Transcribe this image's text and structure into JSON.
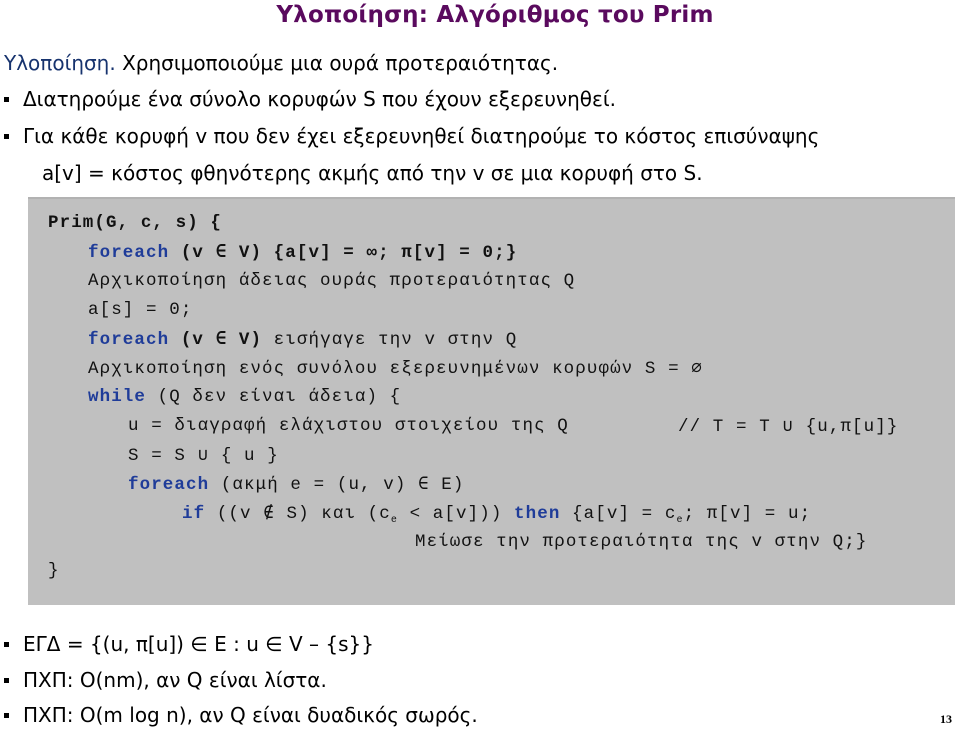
{
  "slide": {
    "title": "Υλοποίηση: Αλγόριθμος του Prim",
    "intro": {
      "keyword": "Υλοποίηση.",
      "text": " Χρησιμοποιούμε μια ουρά προτεραιότητας."
    },
    "bullets_top": [
      "Διατηρούμε ένα σύνολο κορυφών S που έχουν εξερευνηθεί.",
      "Για κάθε κορυφή v που δεν έχει εξερευνηθεί διατηρούμε το κόστος επισύναψης"
    ],
    "bullet_continuation": "a[v] = κόστος φθηνότερης ακμής από την v σε μια κορυφή στο S.",
    "code": {
      "l1": "Prim(G, c, s) {",
      "l2_kw": "foreach",
      "l2_rest": " (v ∈ V) {a[v] = ∞; π[v] = 0;}",
      "l3": "Αρχικοποίηση άδειας ουράς προτεραιότητας Q",
      "l4": "a[s] = 0;",
      "l5_kw": "foreach",
      "l5_rest_b": " (v ∈ V)",
      "l5_rest": " εισήγαγε την v στην Q",
      "l6": "Αρχικοποίηση ενός συνόλου εξερευνημένων κορυφών S = ∅",
      "l7_kw": "while",
      "l7_rest": " (Q δεν είναι άδεια) {",
      "l8": "u = διαγραφή ελάχιστου στοιχείου της Q",
      "l8_comment": "// T = T ∪ {u,π[u]}",
      "l9": "S = S ∪ { u }",
      "l10_kw": "foreach",
      "l10_rest": " (ακμή e = (u, v) ∈ E)",
      "l11_kw": "if",
      "l11_a": " ((v ∉ S) και (c",
      "l11_sub": "e",
      "l11_b": " < a[v])) ",
      "l11_then": "then",
      "l11_c": " {a[v] = c",
      "l11_sub2": "e",
      "l11_d": "; π[v] = u;",
      "l12": "Μείωσε την προτεραιότητα της v στην Q;}",
      "l13": "}"
    },
    "bullets_bottom": [
      "ΕΓΔ = {(u, π[u]) ∈ E : u ∈ V – {s}}",
      "ΠΧΠ: O(nm), αν Q είναι λίστα.",
      "ΠΧΠ: O(m log n), αν Q είναι δυαδικός σωρός."
    ],
    "page_number": "13"
  }
}
